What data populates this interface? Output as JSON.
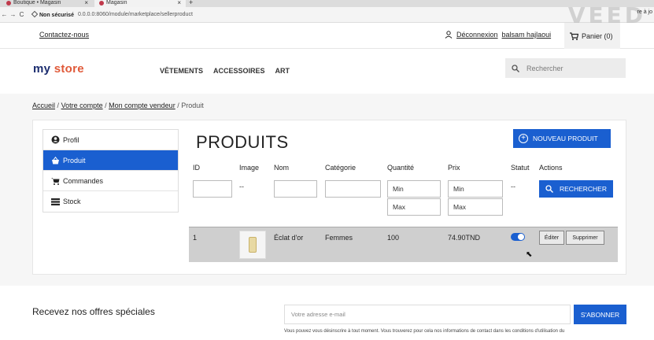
{
  "browser": {
    "tabs": [
      "Boutique • Magasin",
      "Magasin"
    ],
    "tab_close": "×",
    "new_tab": "+",
    "nav": [
      "←",
      "→",
      "C"
    ],
    "security": "Non sécurisé",
    "url": "0.0.0.0:8060/module/marketplace/sellerproduct",
    "watermark": "VEED",
    "ext_text": "re à jo"
  },
  "topnav": {
    "contact": "Contactez-nous",
    "logout": "Déconnexion",
    "username": "balsam hajlaoui",
    "cart": "Panier (0)"
  },
  "header": {
    "logo_part1": "my ",
    "logo_part2": "store",
    "menu": [
      "VÊTEMENTS",
      "ACCESSOIRES",
      "ART"
    ],
    "search_placeholder": "Rechercher"
  },
  "breadcrumb": {
    "items": [
      "Accueil",
      "Votre compte",
      "Mon compte vendeur"
    ],
    "current": "Produit",
    "sep": "/"
  },
  "sidebar": {
    "items": [
      {
        "label": "Profil",
        "icon": "account-icon"
      },
      {
        "label": "Produit",
        "icon": "basket-icon"
      },
      {
        "label": "Commandes",
        "icon": "cart-icon"
      },
      {
        "label": "Stock",
        "icon": "list-icon"
      }
    ],
    "active_index": 1
  },
  "products": {
    "title": "PRODUITS",
    "new_button": "NOUVEAU PRODUIT",
    "columns": [
      "ID",
      "Image",
      "Nom",
      "Catégorie",
      "Quantité",
      "Prix",
      "Statut",
      "Actions"
    ],
    "filters": {
      "image_dash": "--",
      "status_dash": "--",
      "qty_min": "Min",
      "qty_max": "Max",
      "price_min": "Min",
      "price_max": "Max",
      "search_button": "RECHERCHER"
    },
    "rows": [
      {
        "id": "1",
        "name": "Éclat d'or",
        "category": "Femmes",
        "quantity": "100",
        "price": "74.90TND",
        "status_on": true,
        "edit": "Éditer",
        "delete": "Supprimer"
      }
    ]
  },
  "footer": {
    "newsletter_title": "Recevez nos offres spéciales",
    "email_placeholder": "Votre adresse e-mail",
    "subscribe": "S'ABONNER",
    "legal": "Vous pouvez vous désinscrire à tout moment. Vous trouverez pour cela nos informations de contact dans les conditions d'utilisation du"
  },
  "colors": {
    "primary": "#1a5fd0",
    "row_bg": "#cfcfcf"
  }
}
